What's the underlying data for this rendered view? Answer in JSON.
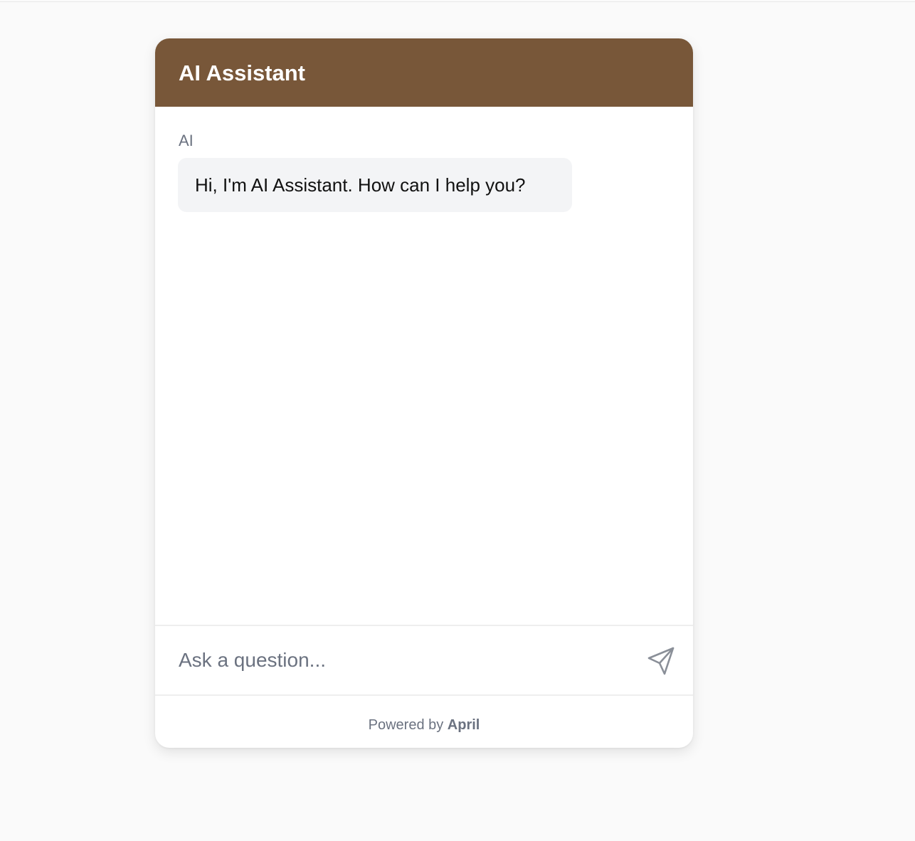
{
  "widget": {
    "title": "AI Assistant",
    "header_color": "#785739"
  },
  "messages": [
    {
      "sender": "AI",
      "text": "Hi, I'm AI Assistant. How can I help you?"
    }
  ],
  "input": {
    "placeholder": "Ask a question...",
    "value": "",
    "send_icon": "send-icon"
  },
  "footer": {
    "prefix": "Powered by",
    "brand": "April"
  }
}
